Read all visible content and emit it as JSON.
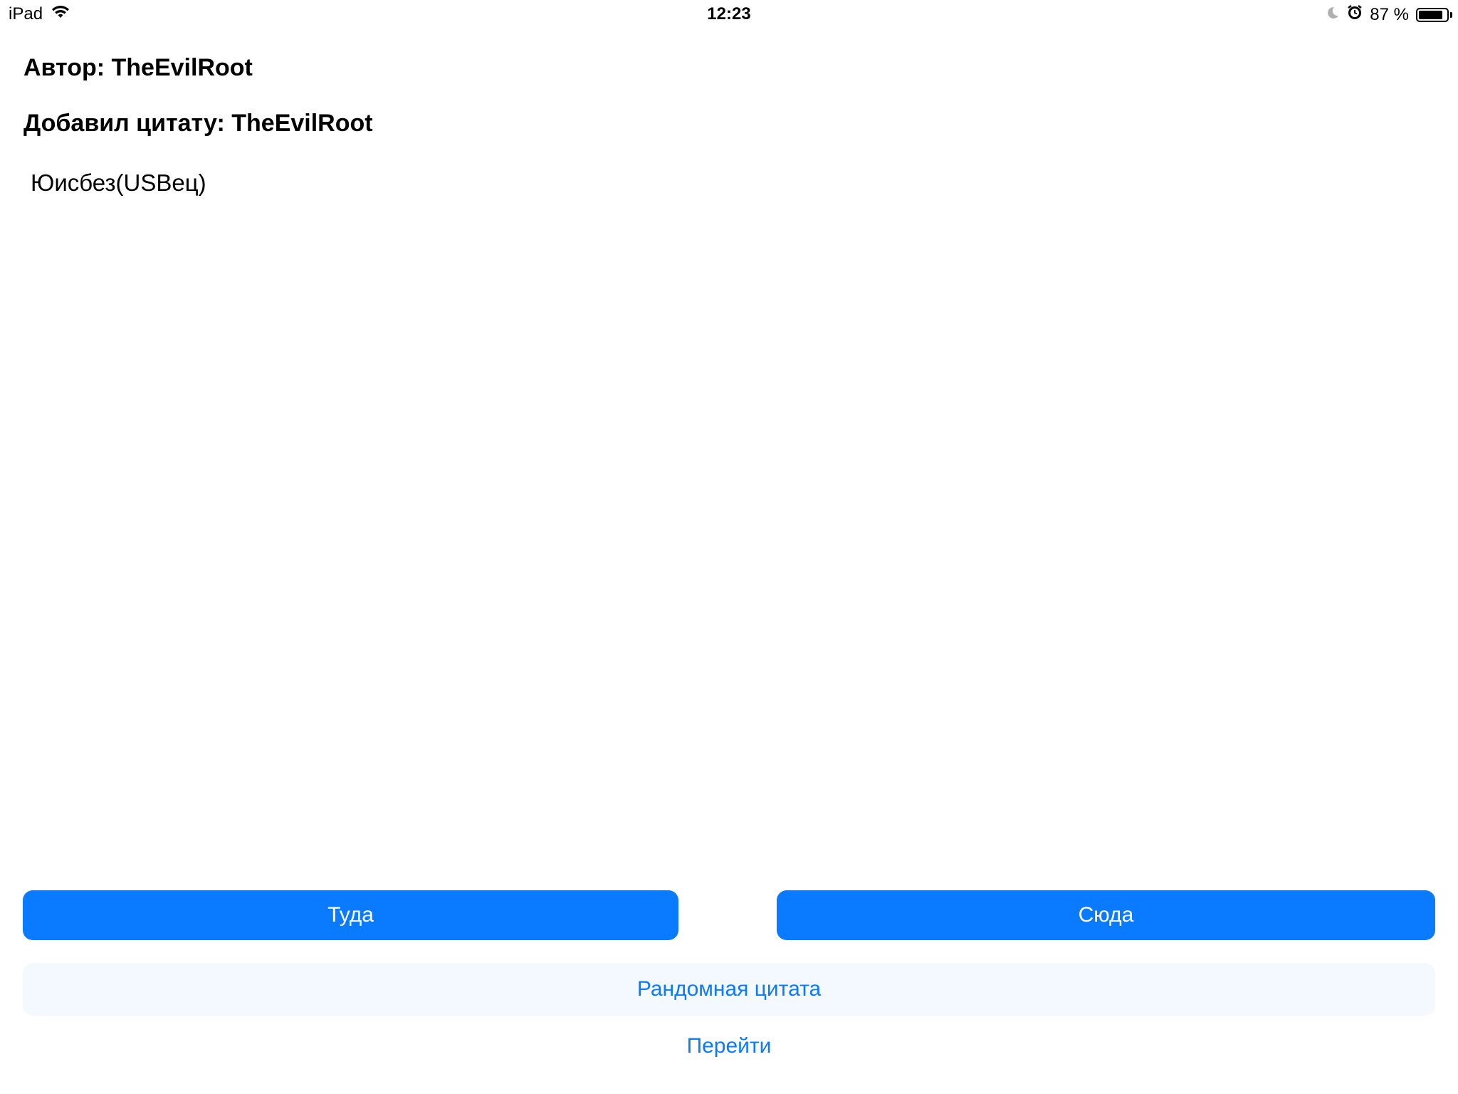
{
  "status_bar": {
    "device": "iPad",
    "time": "12:23",
    "battery_percent": "87 %",
    "battery_level": 0.87,
    "icons": [
      "wifi-icon",
      "moon-icon",
      "alarm-icon",
      "battery-icon"
    ]
  },
  "quote": {
    "author_line": "Автор: TheEvilRoot",
    "added_by_line": "Добавил цитату: TheEvilRoot",
    "text": "Юисбез(USВец)"
  },
  "buttons": {
    "back_label": "Туда",
    "forward_label": "Сюда",
    "random_label": "Рандомная цитата",
    "go_label": "Перейти"
  },
  "colors": {
    "accent": "#0a7aff",
    "random_bg": "#f3f9fe"
  }
}
